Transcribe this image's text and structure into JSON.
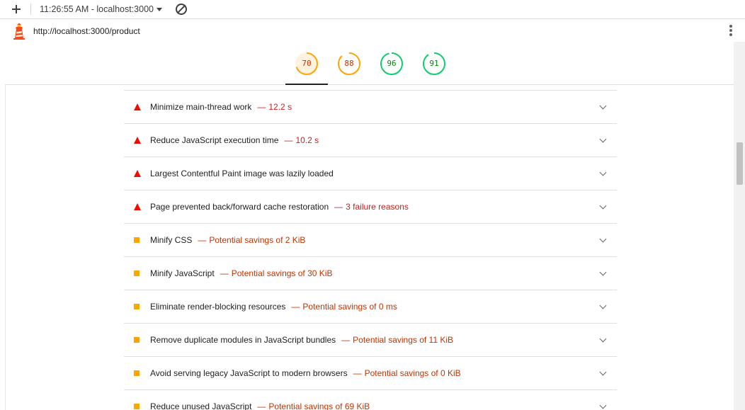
{
  "toolbar": {
    "session_label": "11:26:55 AM - localhost:3000",
    "new_label": "New report",
    "clear_label": "Clear"
  },
  "urlbar": {
    "url": "http://localhost:3000/product"
  },
  "scores": [
    {
      "value": "70",
      "score": 0.7,
      "color": "#ffa400",
      "text_color": "#c33300",
      "bg": "#fff3e0"
    },
    {
      "value": "88",
      "score": 0.88,
      "color": "#ffa400",
      "text_color": "#c33300",
      "bg": "#ffffff"
    },
    {
      "value": "96",
      "score": 0.96,
      "color": "#0cce6b",
      "text_color": "#008800",
      "bg": "#ffffff"
    },
    {
      "value": "91",
      "score": 0.91,
      "color": "#0cce6b",
      "text_color": "#008800",
      "bg": "#ffffff"
    }
  ],
  "audits": [
    {
      "title": "Minimize main-thread work",
      "dash": "—",
      "display": "12.2 s",
      "level": "fail"
    },
    {
      "title": "Reduce JavaScript execution time",
      "dash": "—",
      "display": "10.2 s",
      "level": "fail"
    },
    {
      "title": "Largest Contentful Paint image was lazily loaded",
      "dash": "",
      "display": "",
      "level": "fail"
    },
    {
      "title": "Page prevented back/forward cache restoration",
      "dash": "—",
      "display": "3 failure reasons",
      "level": "fail"
    },
    {
      "title": "Minify CSS",
      "dash": "—",
      "display": "Potential savings of 2 KiB",
      "level": "avg"
    },
    {
      "title": "Minify JavaScript",
      "dash": "—",
      "display": "Potential savings of 30 KiB",
      "level": "avg"
    },
    {
      "title": "Eliminate render-blocking resources",
      "dash": "—",
      "display": "Potential savings of 0 ms",
      "level": "avg"
    },
    {
      "title": "Remove duplicate modules in JavaScript bundles",
      "dash": "—",
      "display": "Potential savings of 11 KiB",
      "level": "avg"
    },
    {
      "title": "Avoid serving legacy JavaScript to modern browsers",
      "dash": "—",
      "display": "Potential savings of 0 KiB",
      "level": "avg"
    },
    {
      "title": "Reduce unused JavaScript",
      "dash": "—",
      "display": "Potential savings of 69 KiB",
      "level": "avg"
    }
  ],
  "icons": {
    "new": "plus-icon",
    "dropdown": "chevron-down-icon",
    "clear": "clear-icon",
    "logo": "lighthouse-logo",
    "menu": "more-vert-icon",
    "fail": "fail-triangle-icon",
    "average": "average-square-icon",
    "expand": "chevron-down-icon"
  }
}
